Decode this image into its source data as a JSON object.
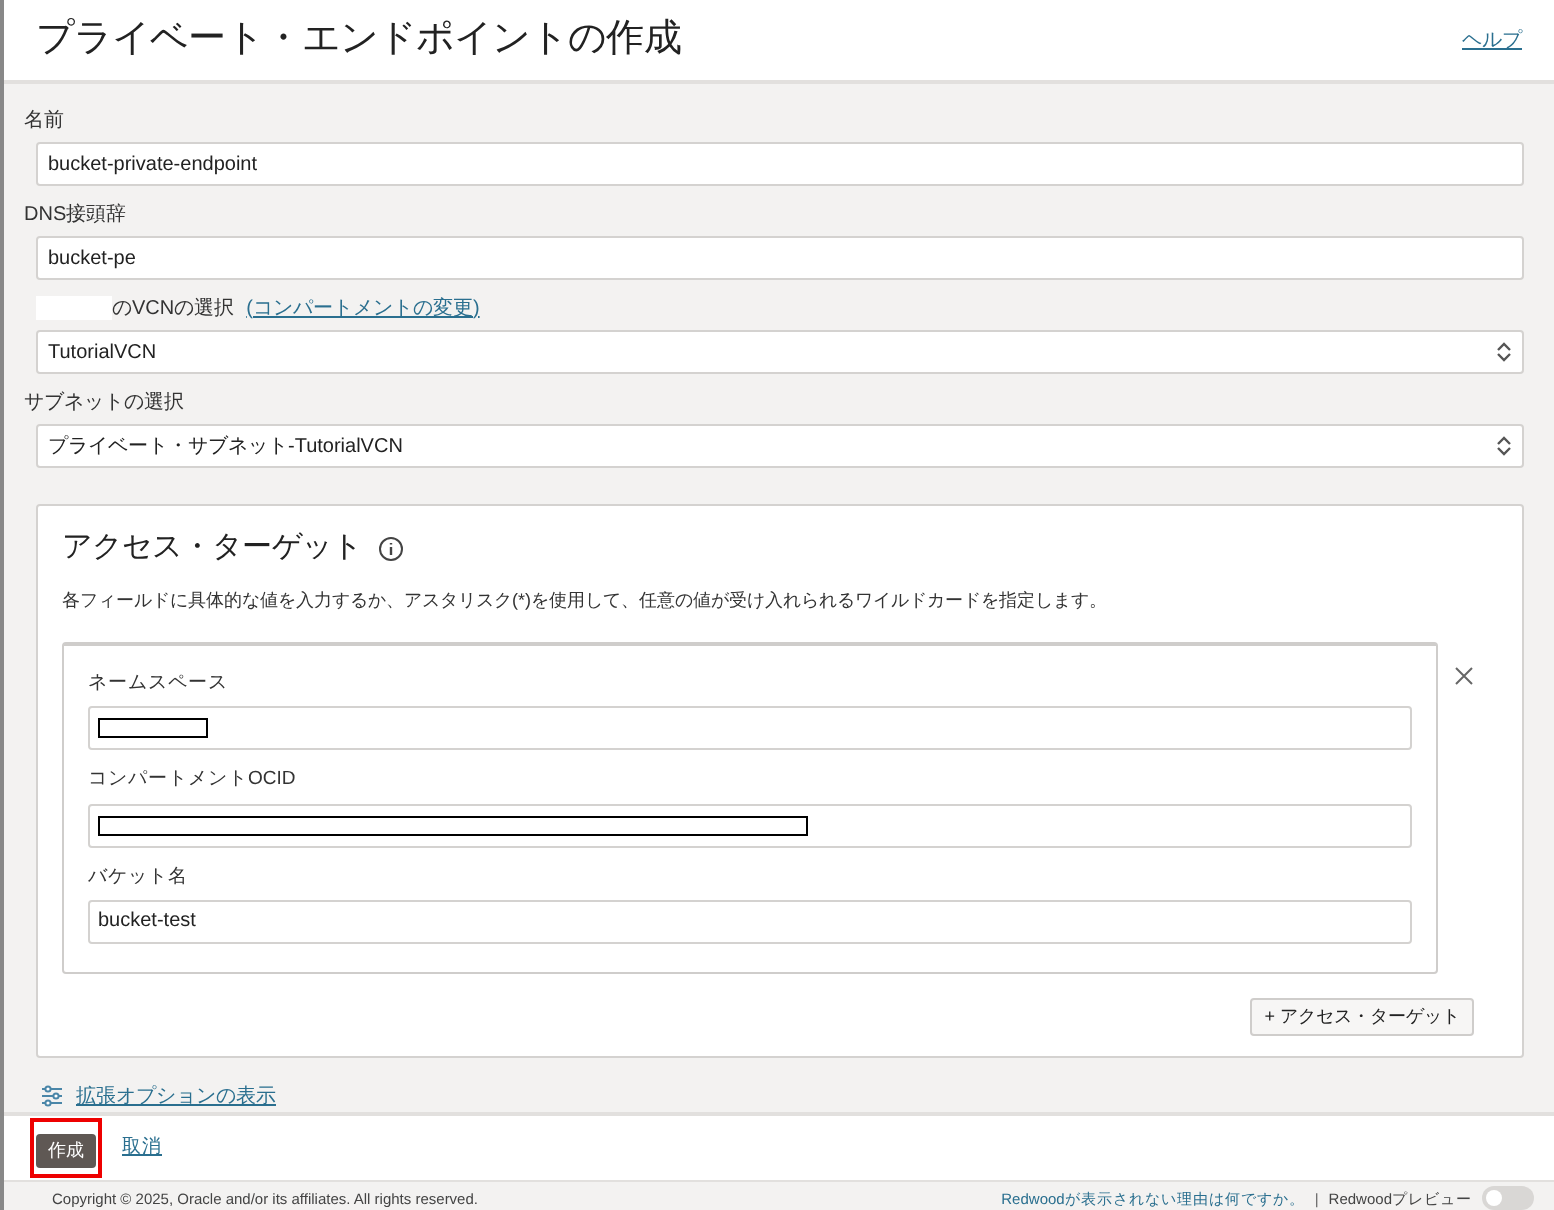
{
  "header": {
    "title": "プライベート・エンドポイントの作成",
    "help_link": "ヘルプ"
  },
  "fields": [
    {
      "kind": "text",
      "label": "名前",
      "value": "bucket-private-endpoint"
    },
    {
      "kind": "text",
      "label": "DNS接頭辞",
      "value": "bucket-pe"
    },
    {
      "kind": "select",
      "label": "のVCNの選択",
      "redacted_prefix": true,
      "link": "(コンパートメントの変更)",
      "value": "TutorialVCN"
    },
    {
      "kind": "select",
      "label": "サブネットの選択",
      "value": "プライベート・サブネット-TutorialVCN"
    }
  ],
  "access_target": {
    "title": "アクセス・ターゲット",
    "description": "各フィールドに具体的な値を入力するか、アスタリスク(*)を使用して、任意の値が受け入れられるワイルドカードを指定します。",
    "fields": [
      {
        "label": "ネームスペース",
        "kind": "redacted_short"
      },
      {
        "label": "コンパートメントOCID",
        "kind": "redacted_long"
      },
      {
        "label": "バケット名",
        "kind": "text",
        "value": "bucket-test"
      }
    ],
    "add_button": "+ アクセス・ターゲット"
  },
  "advanced_link": "拡張オプションの表示",
  "actions": {
    "create": "作成",
    "cancel": "取消"
  },
  "footer": {
    "copyright": "Copyright © 2025, Oracle and/or its affiliates. All rights reserved.",
    "why_link": "Redwoodが表示されない理由は何ですか。",
    "separator": "|",
    "preview_label": "Redwoodプレビュー",
    "preview_on": false
  }
}
